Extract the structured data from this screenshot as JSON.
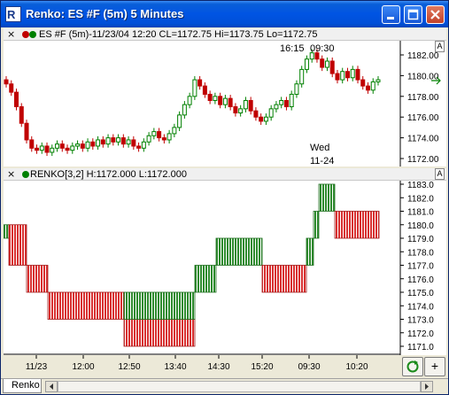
{
  "window": {
    "title": "Renko: ES #F (5m) 5 Minutes",
    "icon": "renko-app-icon",
    "buttons": [
      "minimize-icon",
      "maximize-icon",
      "close-icon"
    ]
  },
  "price_pane": {
    "close_symbol": "×",
    "header_text": "ES #F (5m)-11/23/04 12:20 CL=1172.75 Hi=1173.75 Lo=1172.75",
    "corner_label": "A",
    "session_labels": {
      "time1": "16:15",
      "time2": "09:30",
      "day": "Wed",
      "date": "11-24"
    },
    "y_ticks": [
      "1182.00",
      "1180.00",
      "1178.00",
      "1176.00",
      "1174.00",
      "1172.00"
    ],
    "colors": {
      "up": "#008000",
      "down": "#c00000",
      "axis": "#000000"
    }
  },
  "renko_pane": {
    "header_text": "RENKO[3,2] H:1172.000 L:1172.000",
    "corner_label": "A",
    "y_ticks": [
      "1183.0",
      "1182.0",
      "1181.0",
      "1180.0",
      "1179.0",
      "1178.0",
      "1177.0",
      "1176.0",
      "1175.0",
      "1174.0",
      "1173.0",
      "1172.0",
      "1171.0"
    ],
    "colors": {
      "up_fill": "#2e8b2e",
      "down_fill": "#d83030",
      "stripe": "#ffffff"
    }
  },
  "x_axis": {
    "labels": [
      "11/23",
      "12:00",
      "12:50",
      "13:40",
      "14:30",
      "15:20",
      "09:30",
      "10:20"
    ]
  },
  "bottom_bar": {
    "refresh_icon": "refresh-icon",
    "add_label": "+"
  },
  "tabs": {
    "active": "Renko"
  },
  "chart_data": [
    {
      "type": "candlestick",
      "title": "ES #F (5m)",
      "ylim": [
        1171,
        1183
      ],
      "candles_close_path": [
        1179.2,
        1178.4,
        1177.0,
        1175.4,
        1173.8,
        1173.0,
        1172.8,
        1173.2,
        1172.6,
        1173.0,
        1173.4,
        1173.0,
        1172.8,
        1173.2,
        1173.4,
        1173.0,
        1173.6,
        1173.2,
        1173.8,
        1173.4,
        1174.0,
        1173.6,
        1174.0,
        1173.4,
        1173.8,
        1173.2,
        1173.0,
        1173.6,
        1174.2,
        1174.6,
        1174.0,
        1173.8,
        1174.4,
        1175.0,
        1176.2,
        1177.2,
        1178.0,
        1179.6,
        1179.0,
        1178.2,
        1177.6,
        1178.0,
        1177.2,
        1177.8,
        1177.0,
        1176.4,
        1176.8,
        1177.6,
        1176.6,
        1176.0,
        1175.6,
        1176.0,
        1176.8,
        1177.2,
        1177.6,
        1177.0,
        1178.2,
        1179.2,
        1180.6,
        1181.6,
        1182.2,
        1181.6,
        1180.8,
        1181.4,
        1180.2,
        1179.6,
        1180.4,
        1179.8,
        1180.6,
        1179.6,
        1179.0,
        1178.6,
        1179.4,
        1179.6
      ]
    },
    {
      "type": "renko",
      "title": "RENKO[3,2]",
      "ylim": [
        1170.5,
        1183.5
      ],
      "bricks": [
        {
          "dir": "up",
          "low": 1179,
          "high": 1180
        },
        {
          "dir": "down",
          "low": 1177,
          "high": 1180
        },
        {
          "dir": "down",
          "low": 1175,
          "high": 1177
        },
        {
          "dir": "down",
          "low": 1173,
          "high": 1175
        },
        {
          "dir": "down",
          "low": 1171,
          "high": 1173
        },
        {
          "dir": "up",
          "low": 1173,
          "high": 1175
        },
        {
          "dir": "up",
          "low": 1175,
          "high": 1177
        },
        {
          "dir": "up",
          "low": 1177,
          "high": 1179
        },
        {
          "dir": "down",
          "low": 1175,
          "high": 1177
        },
        {
          "dir": "up",
          "low": 1177,
          "high": 1179
        },
        {
          "dir": "up",
          "low": 1179,
          "high": 1181
        },
        {
          "dir": "up",
          "low": 1181,
          "high": 1183
        },
        {
          "dir": "down",
          "low": 1179,
          "high": 1181
        }
      ]
    }
  ]
}
